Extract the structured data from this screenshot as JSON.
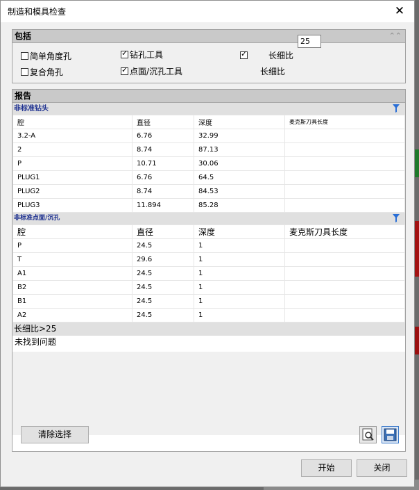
{
  "window": {
    "title": "制造和模具检查",
    "close_glyph": "✕"
  },
  "include": {
    "header": "包括",
    "simple_angle_hole": {
      "label": "简单角度孔",
      "checked": false
    },
    "drill_tool": {
      "label": "钻孔工具",
      "checked": true
    },
    "slenderness_check": {
      "label": "长细比",
      "checked": true
    },
    "compound_angle_hole": {
      "label": "复合角孔",
      "checked": false
    },
    "spotface_tool": {
      "label": "点面/沉孔工具",
      "checked": true
    },
    "slenderness_label": "长细比",
    "slenderness_value": "25"
  },
  "report": {
    "header": "报告",
    "nonstandard_drill": {
      "title": "非标准钻头",
      "columns": [
        "腔",
        "直径",
        "深度",
        "麦克斯刀具长度"
      ],
      "rows": [
        [
          "3.2-A",
          "6.76",
          "32.99",
          ""
        ],
        [
          "2",
          "8.74",
          "87.13",
          ""
        ],
        [
          "P",
          "10.71",
          "30.06",
          ""
        ],
        [
          "PLUG1",
          "6.76",
          "64.5",
          ""
        ],
        [
          "PLUG2",
          "8.74",
          "84.53",
          ""
        ],
        [
          "PLUG3",
          "11.894",
          "85.28",
          ""
        ]
      ]
    },
    "nonstandard_spotface": {
      "title": "非标准点面/沉孔",
      "columns": [
        "腔",
        "直径",
        "深度",
        "麦克斯刀具长度"
      ],
      "rows": [
        [
          "P",
          "24.5",
          "1",
          ""
        ],
        [
          "T",
          "29.6",
          "1",
          ""
        ],
        [
          "A1",
          "24.5",
          "1",
          ""
        ],
        [
          "B2",
          "24.5",
          "1",
          ""
        ],
        [
          "B1",
          "24.5",
          "1",
          ""
        ],
        [
          "A2",
          "24.5",
          "1",
          ""
        ]
      ]
    },
    "slenderness": {
      "title": "长细比>25",
      "message": "未找到问题"
    },
    "clear_selection": "清除选择"
  },
  "footer": {
    "start": "开始",
    "close": "关闭"
  },
  "colors": {
    "group_title": "#1c2f8f",
    "filter_icon": "#2a6fd6",
    "section_header": "#c9c9c9"
  }
}
